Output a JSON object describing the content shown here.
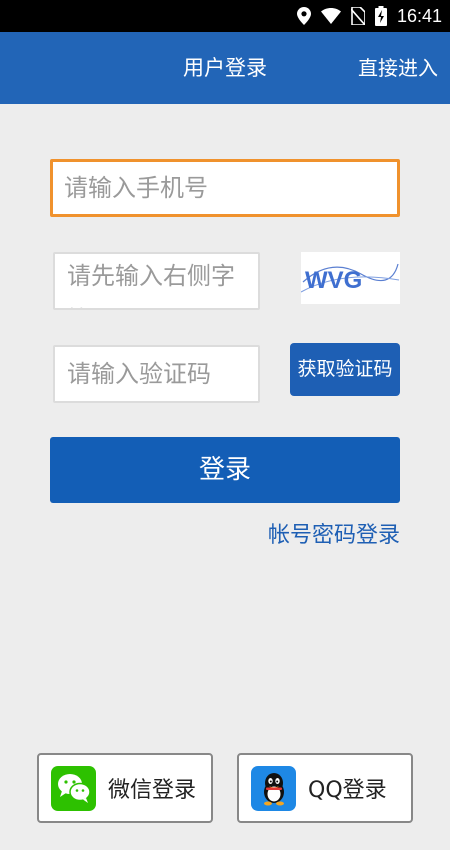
{
  "status_bar": {
    "time": "16:41",
    "icons": [
      "location-icon",
      "wifi-icon",
      "no-sim-icon",
      "battery-charging-icon"
    ]
  },
  "header": {
    "title": "用户登录",
    "action_label": "直接进入"
  },
  "form": {
    "phone_placeholder": "请输入手机号",
    "captcha_placeholder": "请先输入右侧字符",
    "captcha_image_text": "WVG",
    "sms_placeholder": "请输入验证码",
    "get_code_label": "获取验证码",
    "login_label": "登录",
    "account_login_link": "帐号密码登录"
  },
  "social": {
    "wechat_label": "微信登录",
    "qq_label": "QQ登录"
  },
  "colors": {
    "primary": "#2265b7",
    "focus_border": "#f0922d",
    "wechat_green": "#2dc100",
    "qq_blue": "#1e88e5"
  }
}
